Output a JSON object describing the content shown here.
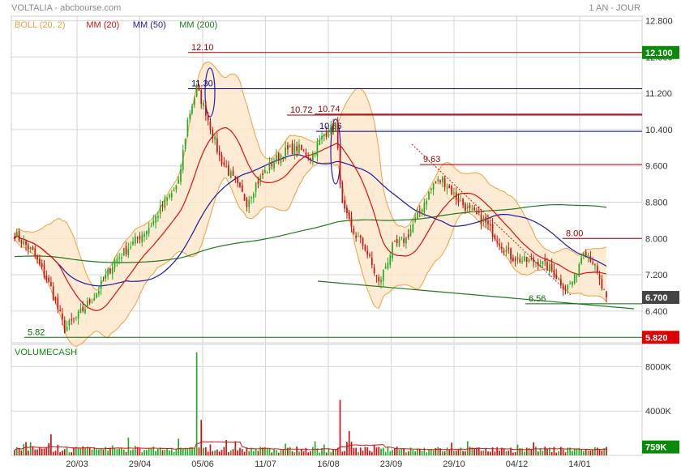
{
  "header": {
    "title": "VOLTALIA - abcbourse.com",
    "period": "1 AN - JOUR"
  },
  "colors": {
    "up": "#22aa22",
    "down": "#cc1111",
    "boll": "#f0a040",
    "boll_fill": "#fde6c8",
    "mm20": "#e01010",
    "mm50": "#1a1aa0",
    "mm200": "#1e7a1e",
    "grid": "#d6d6d6",
    "label_bg": "#0a8a0a",
    "label_bg_red": "#dd0000"
  },
  "legend": [
    {
      "label": "BOLL (20, 2)",
      "color": "#f0a040"
    },
    {
      "label": "MM (20)",
      "color": "#e01010"
    },
    {
      "label": "MM (50)",
      "color": "#1a1aa0"
    },
    {
      "label": "MM (200)",
      "color": "#1e7a1e"
    }
  ],
  "chart_data": {
    "type": "candlestick",
    "title": "VOLTALIA - abcbourse.com",
    "ylim": [
      5.7,
      12.9
    ],
    "y_ticks": [
      "12.800",
      "12.000",
      "11.200",
      "10.400",
      "9.600",
      "8.800",
      "8.000",
      "7.200",
      "6.400"
    ],
    "x_ticks": [
      "20/03",
      "29/04",
      "05/06",
      "11/07",
      "16/08",
      "23/09",
      "29/10",
      "04/12",
      "14/01"
    ],
    "price_anchors": [
      [
        0,
        8.1
      ],
      [
        8,
        7.7
      ],
      [
        16,
        6.9
      ],
      [
        22,
        6.0
      ],
      [
        28,
        6.3
      ],
      [
        36,
        6.8
      ],
      [
        44,
        7.5
      ],
      [
        52,
        7.9
      ],
      [
        60,
        8.3
      ],
      [
        66,
        8.8
      ],
      [
        72,
        9.2
      ],
      [
        76,
        10.6
      ],
      [
        80,
        11.3
      ],
      [
        84,
        10.8
      ],
      [
        90,
        9.8
      ],
      [
        96,
        9.3
      ],
      [
        102,
        8.8
      ],
      [
        106,
        9.2
      ],
      [
        112,
        9.6
      ],
      [
        118,
        9.9
      ],
      [
        124,
        10.0
      ],
      [
        130,
        9.8
      ],
      [
        136,
        10.3
      ],
      [
        141,
        10.5
      ],
      [
        144,
        8.7
      ],
      [
        148,
        8.2
      ],
      [
        154,
        7.8
      ],
      [
        160,
        7.0
      ],
      [
        166,
        7.8
      ],
      [
        172,
        8.0
      ],
      [
        178,
        8.6
      ],
      [
        184,
        9.2
      ],
      [
        188,
        9.3
      ],
      [
        194,
        8.9
      ],
      [
        200,
        8.6
      ],
      [
        206,
        8.4
      ],
      [
        212,
        8.0
      ],
      [
        218,
        7.6
      ],
      [
        224,
        7.5
      ],
      [
        230,
        7.5
      ],
      [
        236,
        7.3
      ],
      [
        242,
        6.9
      ],
      [
        246,
        7.1
      ],
      [
        250,
        7.8
      ],
      [
        254,
        7.5
      ],
      [
        258,
        6.9
      ],
      [
        260,
        6.7
      ]
    ],
    "price_last": 6.7,
    "levels": [
      {
        "value": 12.1,
        "label": "12.10",
        "color": "#990000",
        "box": "12.100",
        "box_color": "#0a8a0a"
      },
      {
        "value": 11.3,
        "label": "11.30",
        "color": "#000080"
      },
      {
        "value": 10.72,
        "label": "10.72",
        "color": "#990000"
      },
      {
        "value": 10.74,
        "label": "10.74",
        "color": "#990000"
      },
      {
        "value": 10.36,
        "label": "10.36",
        "color": "#000080"
      },
      {
        "value": 9.63,
        "label": "9.63",
        "color": "#990000"
      },
      {
        "value": 8.0,
        "label": "8.00",
        "color": "#990000"
      },
      {
        "value": 6.56,
        "label": "6.56",
        "color": "#0a6a0a"
      },
      {
        "value": 5.82,
        "label": "5.82",
        "color": "#0a6a0a",
        "box": "5.820",
        "box_color": "#dd0000"
      }
    ],
    "current_price_label": "6.700",
    "volume": {
      "label": "VOLUMECASH",
      "ylim": [
        0,
        10000000
      ],
      "y_ticks": [
        "8000K",
        "4000K"
      ],
      "last_label": "759K"
    }
  }
}
